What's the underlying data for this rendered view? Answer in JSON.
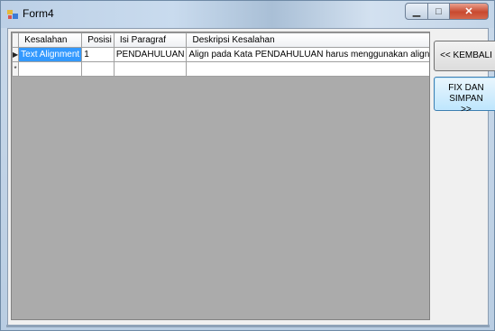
{
  "window": {
    "title": "Form4"
  },
  "grid": {
    "columns": [
      "Kesalahan",
      "Posisi",
      "Isi Paragraf",
      "Deskripsi Kesalahan"
    ],
    "rows": [
      {
        "marker": "▶",
        "cells": [
          "Text Alignment",
          "1",
          "PENDAHULUAN",
          "Align pada Kata PENDAHULUAN harus menggunakan align Justify"
        ]
      }
    ],
    "new_row_marker": "*"
  },
  "buttons": {
    "back_label": "<< KEMBALI",
    "fix_label_line1": "FIX DAN SIMPAN",
    "fix_label_line2": ">>"
  },
  "colors": {
    "selection": "#3399ff",
    "grid_background": "#ababab",
    "close_button": "#c8492f"
  }
}
